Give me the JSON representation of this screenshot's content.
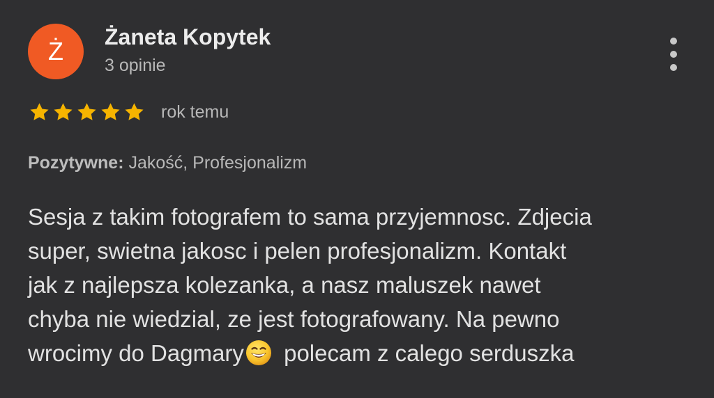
{
  "review": {
    "author": {
      "initial": "Ż",
      "name": "Żaneta Kopytek",
      "reviews_count_text": "3 opinie"
    },
    "menu_icon": "more-vertical-icon",
    "rating": {
      "stars": 5,
      "max": 5,
      "time_ago": "rok temu"
    },
    "positive": {
      "label": "Pozytywne:",
      "values": " Jakość, Profesjonalizm"
    },
    "body": {
      "line1": "Sesja z takim fotografem to sama przyjemnosc. Zdjecia",
      "line2": "super, swietna jakosc i pelen profesjonalizm. Kontakt",
      "line3": "jak z najlepsza kolezanka, a nasz maluszek nawet",
      "line4": "chyba nie wiedzial, ze jest fotografowany. Na pewno",
      "line5_before_emoji": "wrocimy do Dagmary",
      "line5_after_emoji": " polecam z calego serduszka"
    }
  },
  "colors": {
    "background": "#2f2f31",
    "avatar": "#f05a24",
    "star": "#f6b400",
    "primary_text": "#ececec",
    "secondary_text": "#b8b8b8"
  }
}
